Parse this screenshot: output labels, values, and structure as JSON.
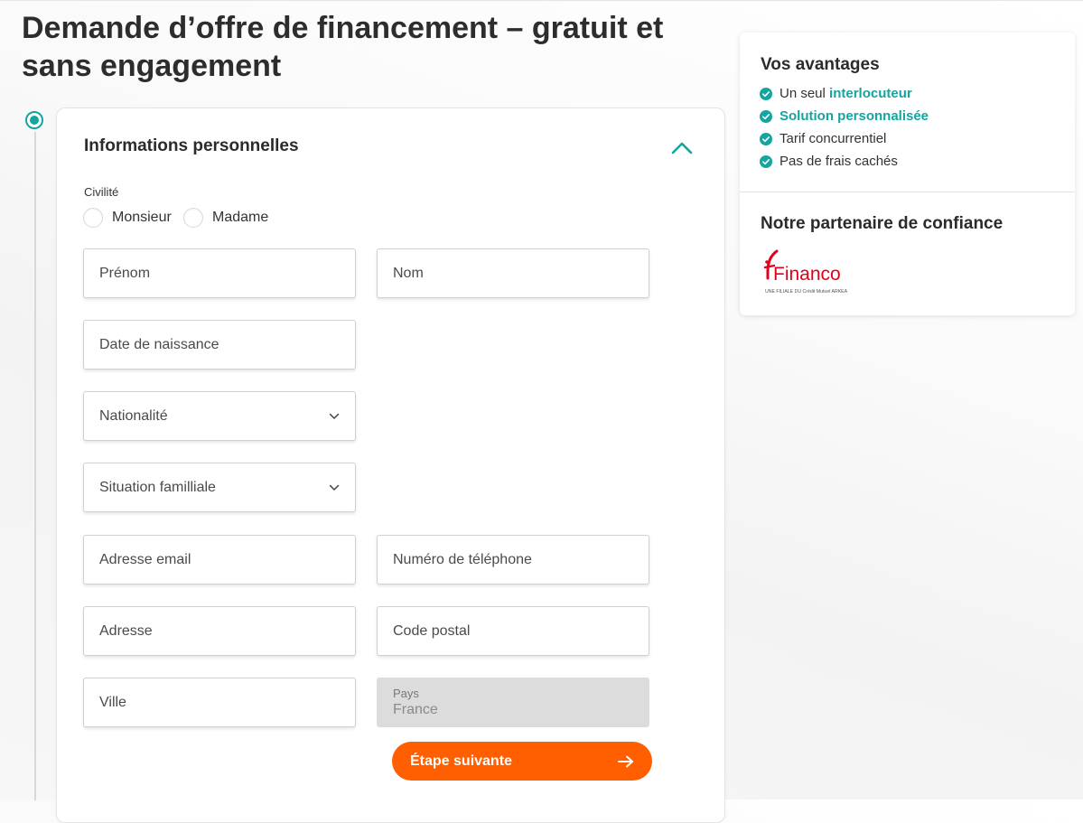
{
  "page": {
    "title": "Demande d’offre de financement – gratuit et sans engagement"
  },
  "form": {
    "section_title": "Informations personnelles",
    "civility": {
      "label": "Civilité",
      "options": [
        "Monsieur",
        "Madame"
      ]
    },
    "fields": {
      "prenom": "Prénom",
      "nom": "Nom",
      "date_naissance": "Date de naissance",
      "nationalite": "Nationalité",
      "situation_familiale": "Situation familliale",
      "email": "Adresse email",
      "telephone": "Numéro de téléphone",
      "adresse": "Adresse",
      "code_postal": "Code postal",
      "ville": "Ville",
      "pays_label": "Pays",
      "pays_value": "France"
    },
    "next_button": "Étape suivante"
  },
  "sidebar": {
    "advantages_title": "Vos avantages",
    "advantages": [
      {
        "plain": "Un seul ",
        "highlight": "interlocuteur"
      },
      {
        "plain": "",
        "highlight": "Solution personnalisée"
      },
      {
        "plain": "Tarif concurrentiel",
        "highlight": ""
      },
      {
        "plain": "Pas de frais cachés",
        "highlight": ""
      }
    ],
    "partner_title": "Notre partenaire de confiance",
    "partner_logo": {
      "name": "Financo",
      "tagline": "UNE FILIALE DU Crédit Mutuel ARKEA"
    }
  },
  "colors": {
    "accent_teal": "#14a5a0",
    "cta_orange": "#ff5f00",
    "logo_red": "#e2001a"
  }
}
